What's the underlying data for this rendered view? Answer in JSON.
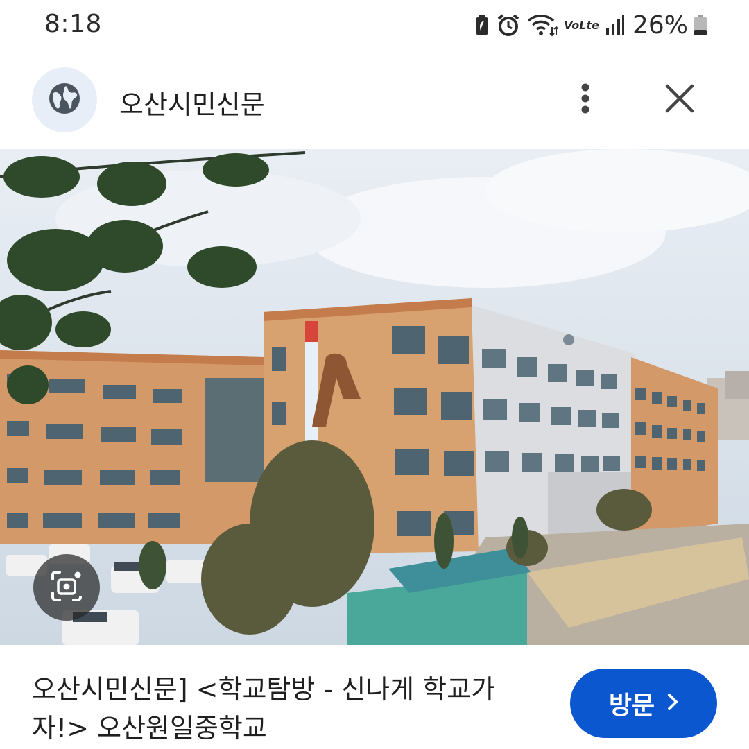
{
  "status_bar": {
    "time": "8:18",
    "volte": "VoLte",
    "battery_percent": "26%",
    "icons": [
      "battery-saver-icon",
      "alarm-icon",
      "wifi-icon",
      "volte-icon",
      "signal-icon",
      "battery-icon"
    ]
  },
  "header": {
    "title": "오산시민신문",
    "icons": [
      "globe-icon",
      "more-vert-icon",
      "close-icon"
    ]
  },
  "image": {
    "description_icon": "google-lens-icon"
  },
  "footer": {
    "caption": "오산시민신문] <학교탐방 - 신나게 학교가자!> 오산원일중학교",
    "visit_button_label": "방문",
    "visit_button_icon": "chevron-right-icon"
  },
  "colors": {
    "accent": "#0b57d0",
    "globe_bg": "#e8eef8",
    "text": "#1f1f1f"
  }
}
